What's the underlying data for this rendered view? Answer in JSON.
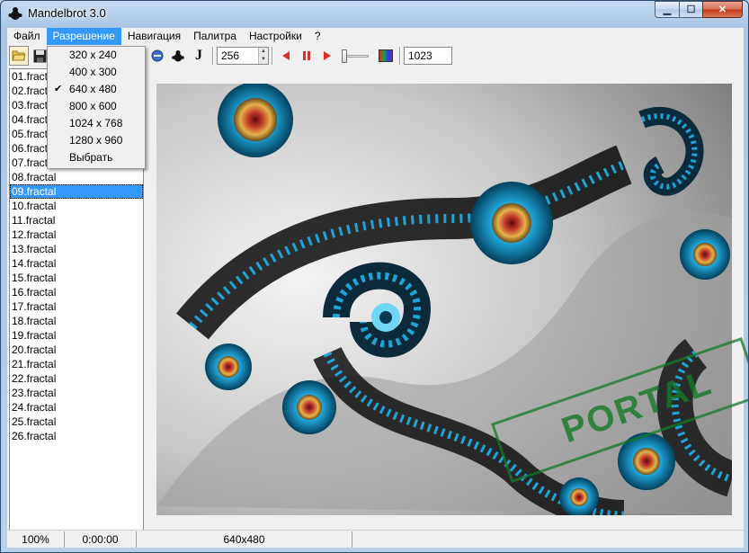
{
  "window": {
    "title": "Mandelbrot 3.0"
  },
  "menu": [
    "Файл",
    "Разрешение",
    "Навигация",
    "Палитра",
    "Настройки",
    "?"
  ],
  "resolution_menu": {
    "items": [
      "320 x 240",
      "400 x 300",
      "640 x 480",
      "800 x 600",
      "1024 x 768",
      "1280 x 960",
      "Выбрать"
    ],
    "checked": "640 x 480"
  },
  "toolbar": {
    "iterations": "256",
    "color_offset": "1023"
  },
  "file_list": {
    "items": [
      "01.fractal",
      "02.fractal",
      "03.fractal",
      "04.fractal",
      "05.fractal",
      "06.fractal",
      "07.fractal",
      "08.fractal",
      "09.fractal",
      "10.fractal",
      "11.fractal",
      "12.fractal",
      "13.fractal",
      "14.fractal",
      "15.fractal",
      "16.fractal",
      "17.fractal",
      "18.fractal",
      "19.fractal",
      "20.fractal",
      "21.fractal",
      "22.fractal",
      "23.fractal",
      "24.fractal",
      "25.fractal",
      "26.fractal"
    ],
    "selected": "09.fractal"
  },
  "status": {
    "zoom": "100%",
    "time": "0:00:00",
    "size": "640x480"
  },
  "watermark": "PORTAL",
  "colors": {
    "accent": "#3399ff",
    "fractal_cyan": "#1fa3d6",
    "fractal_gold": "#d8a13a"
  }
}
